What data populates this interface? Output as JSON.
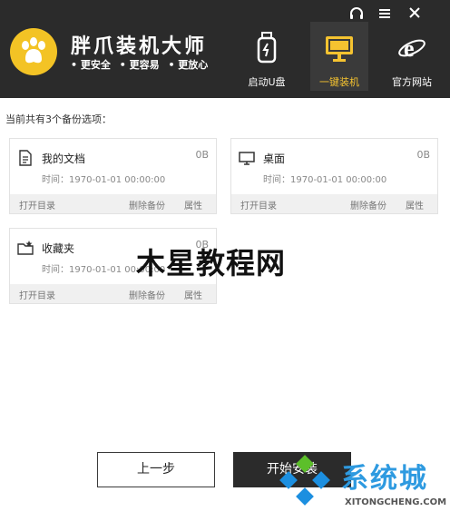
{
  "app": {
    "title": "胖爪装机大师",
    "slogans": [
      "• 更安全",
      "• 更容易",
      "• 更放心"
    ]
  },
  "nav": [
    {
      "label": "启动U盘",
      "icon": "usb-drive-icon"
    },
    {
      "label": "一键装机",
      "icon": "monitor-icon",
      "active": true
    },
    {
      "label": "官方网站",
      "icon": "ie-browser-icon"
    }
  ],
  "window_controls": [
    "headset-icon",
    "menu-icon",
    "close-icon"
  ],
  "backup": {
    "count_text": "当前共有3个备份选项：",
    "items": [
      {
        "name": "我的文档",
        "size": "0B",
        "time": "时间：1970-01-01 00:00:00",
        "icon": "document-icon"
      },
      {
        "name": "桌面",
        "size": "0B",
        "time": "时间：1970-01-01 00:00:00",
        "icon": "desktop-icon"
      },
      {
        "name": "收藏夹",
        "size": "0B",
        "time": "时间：1970-01-01 00:00:00",
        "icon": "favorites-folder-icon"
      }
    ],
    "actions": {
      "open": "打开目录",
      "delete": "删除备份",
      "properties": "属性"
    }
  },
  "buttons": {
    "prev": "上一步",
    "start": "开始安装"
  },
  "watermarks": {
    "center": "木星教程网",
    "brand": "系统城",
    "url": "XITONGCHENG.COM"
  },
  "colors": {
    "header_bg": "#2b2b2b",
    "accent": "#f5c330",
    "watermark_blue": "#2e9ae0"
  }
}
